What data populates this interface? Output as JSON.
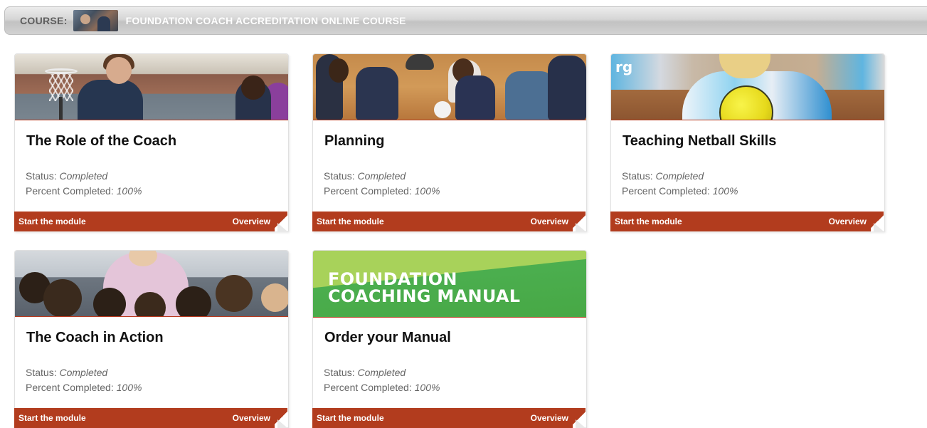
{
  "course": {
    "label": "COURSE:",
    "title": "FOUNDATION COACH ACCREDITATION ONLINE COURSE"
  },
  "labels": {
    "status": "Status:",
    "percent": "Percent Completed:",
    "start": "Start the module",
    "overview": "Overview"
  },
  "modules": [
    {
      "title": "The Role of the Coach",
      "status": "Completed",
      "percent": "100%"
    },
    {
      "title": "Planning",
      "status": "Completed",
      "percent": "100%"
    },
    {
      "title": "Teaching Netball Skills",
      "status": "Completed",
      "percent": "100%"
    },
    {
      "title": "The Coach in Action",
      "status": "Completed",
      "percent": "100%"
    },
    {
      "title": "Order your Manual",
      "status": "Completed",
      "percent": "100%",
      "image_text_line1": "FOUNDATION",
      "image_text_line2": "COACHING MANUAL"
    }
  ],
  "netball_logo_text": "rg",
  "colors": {
    "footer": "#b23c1e",
    "manual_green": "#4caf50",
    "header_text": "#5e5e5e"
  }
}
